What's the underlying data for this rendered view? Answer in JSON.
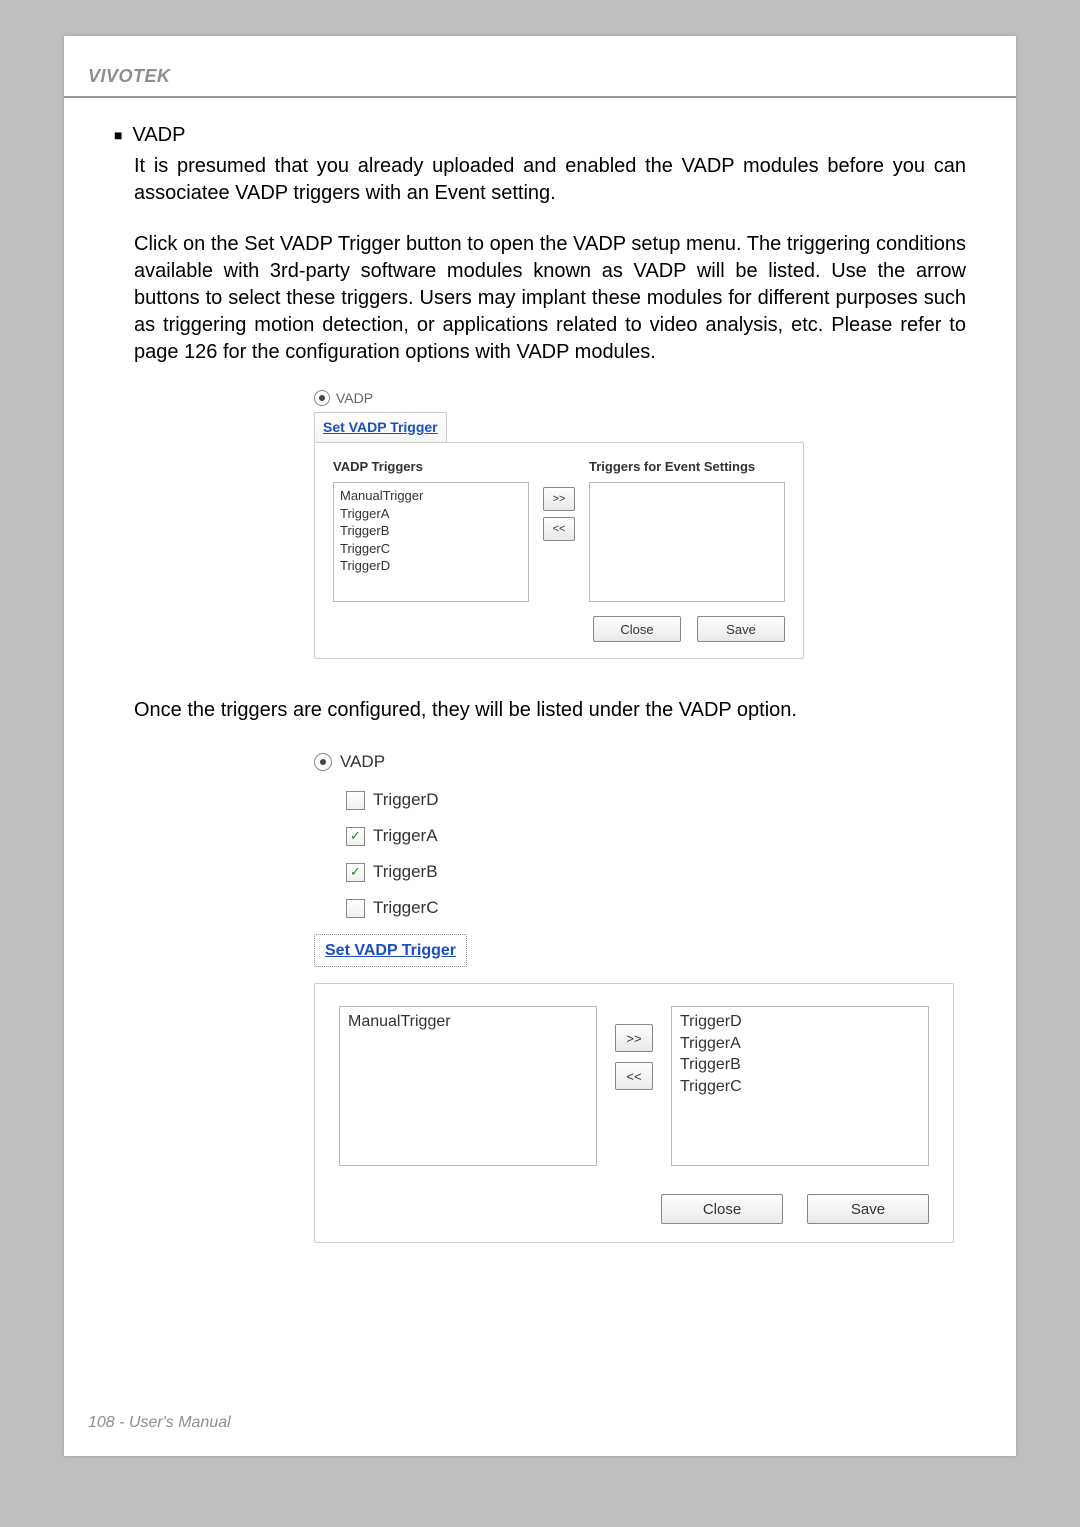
{
  "brand": "VIVOTEK",
  "section": {
    "bullet": "■",
    "title": "VADP",
    "para1": "It is presumed that you already uploaded and enabled the VADP modules before you can associatee VADP triggers with an Event setting.",
    "para2": "Click on the Set VADP Trigger button to open the VADP setup menu. The triggering conditions available with 3rd-party software modules known as VADP will be listed. Use the arrow buttons to select these triggers. Users may implant these modules for different purposes such as triggering motion detection, or applications related to video analysis, etc. Please refer to page 126 for the configuration options with VADP modules.",
    "mid_text": "Once the triggers are configured, they will be listed under the VADP option."
  },
  "dlg1": {
    "radio_label": "VADP",
    "link": "Set VADP Trigger",
    "left_title": "VADP Triggers",
    "right_title": "Triggers for Event Settings",
    "left_items": [
      "ManualTrigger",
      "TriggerA",
      "TriggerB",
      "TriggerC",
      "TriggerD"
    ],
    "right_items": [],
    "arrow_right": ">>",
    "arrow_left": "<<",
    "close": "Close",
    "save": "Save"
  },
  "dlg2": {
    "radio_label": "VADP",
    "checks": [
      {
        "label": "TriggerD",
        "checked": false
      },
      {
        "label": "TriggerA",
        "checked": true
      },
      {
        "label": "TriggerB",
        "checked": true
      },
      {
        "label": "TriggerC",
        "checked": false
      }
    ],
    "link": "Set VADP Trigger",
    "left_items": [
      "ManualTrigger"
    ],
    "right_items": [
      "TriggerD",
      "TriggerA",
      "TriggerB",
      "TriggerC"
    ],
    "arrow_right": ">>",
    "arrow_left": "<<",
    "close": "Close",
    "save": "Save"
  },
  "footer": "108 - User's Manual"
}
